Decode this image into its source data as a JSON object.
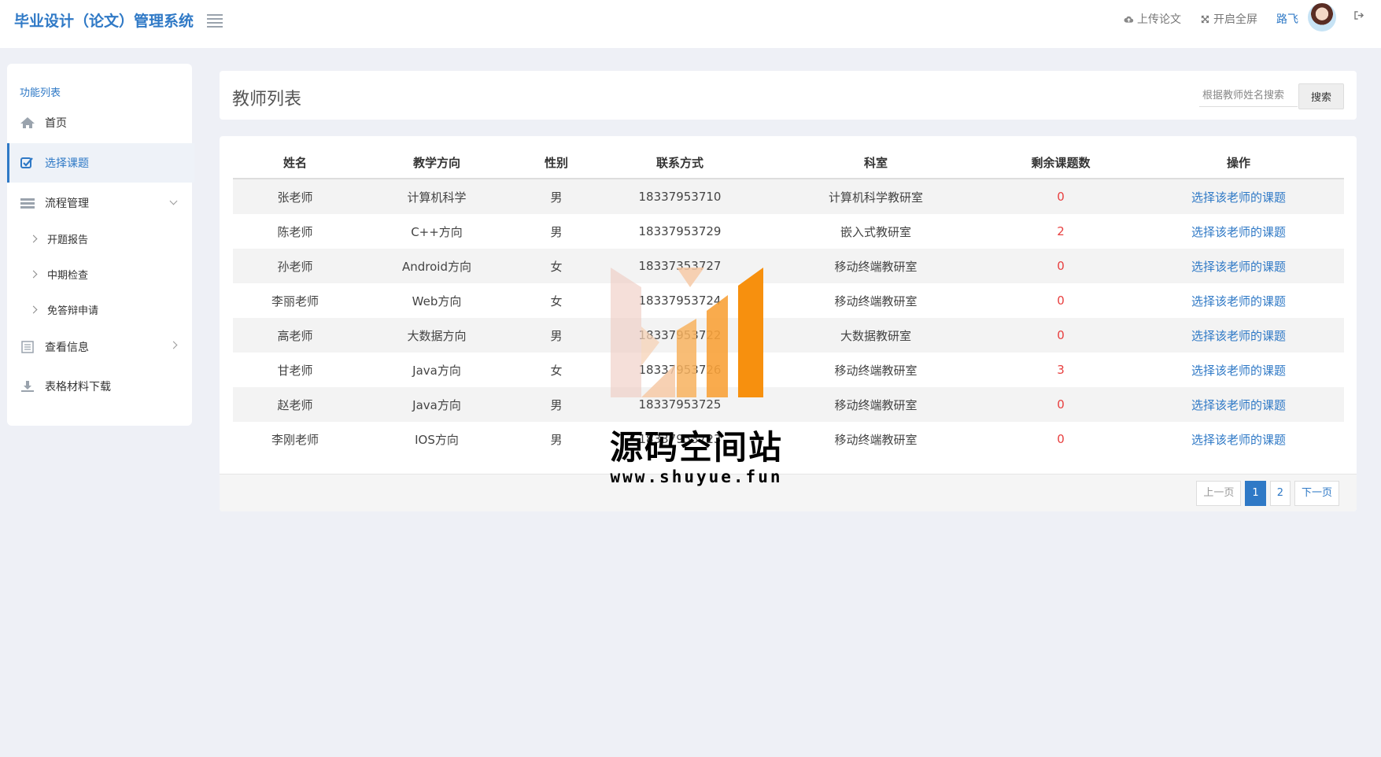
{
  "app": {
    "title": "毕业设计（论文）管理系统"
  },
  "topbar": {
    "upload": "上传论文",
    "fullscreen": "开启全屏",
    "user": "路飞"
  },
  "sidebar": {
    "title": "功能列表",
    "items": [
      {
        "label": "首页",
        "icon": "home-icon"
      },
      {
        "label": "选择课题",
        "icon": "check-square-icon"
      },
      {
        "label": "流程管理",
        "icon": "list-icon"
      },
      {
        "label": "查看信息",
        "icon": "clipboard-icon"
      },
      {
        "label": "表格材料下载",
        "icon": "download-icon"
      }
    ],
    "subitems": [
      "开题报告",
      "中期检查",
      "免答辩申请"
    ]
  },
  "page": {
    "title": "教师列表"
  },
  "search": {
    "placeholder": "根据教师姓名搜索",
    "button": "搜索"
  },
  "table": {
    "headers": [
      "姓名",
      "教学方向",
      "性别",
      "联系方式",
      "科室",
      "剩余课题数",
      "操作"
    ],
    "rows": [
      {
        "name": "张老师",
        "direction": "计算机科学",
        "gender": "男",
        "phone": "18337953710",
        "dept": "计算机科学教研室",
        "count": "0",
        "action": "选择该老师的课题"
      },
      {
        "name": "陈老师",
        "direction": "C++方向",
        "gender": "男",
        "phone": "18337953729",
        "dept": "嵌入式教研室",
        "count": "2",
        "action": "选择该老师的课题"
      },
      {
        "name": "孙老师",
        "direction": "Android方向",
        "gender": "女",
        "phone": "18337353727",
        "dept": "移动终端教研室",
        "count": "0",
        "action": "选择该老师的课题"
      },
      {
        "name": "李丽老师",
        "direction": "Web方向",
        "gender": "女",
        "phone": "18337953724",
        "dept": "移动终端教研室",
        "count": "0",
        "action": "选择该老师的课题"
      },
      {
        "name": "高老师",
        "direction": "大数据方向",
        "gender": "男",
        "phone": "18337953722",
        "dept": "大数据教研室",
        "count": "0",
        "action": "选择该老师的课题"
      },
      {
        "name": "甘老师",
        "direction": "Java方向",
        "gender": "女",
        "phone": "18337953726",
        "dept": "移动终端教研室",
        "count": "3",
        "action": "选择该老师的课题"
      },
      {
        "name": "赵老师",
        "direction": "Java方向",
        "gender": "男",
        "phone": "18337953725",
        "dept": "移动终端教研室",
        "count": "0",
        "action": "选择该老师的课题"
      },
      {
        "name": "李刚老师",
        "direction": "IOS方向",
        "gender": "男",
        "phone": "18337953723",
        "dept": "移动终端教研室",
        "count": "0",
        "action": "选择该老师的课题"
      }
    ]
  },
  "pagination": {
    "prev": "上一页",
    "pages": [
      "1",
      "2"
    ],
    "current": "1",
    "next": "下一页"
  },
  "watermark": {
    "text": "源码空间站",
    "url": "www.shuyue.fun"
  },
  "colors": {
    "accent": "#2f79c6",
    "count": "#e84040",
    "background": "#eef0f6"
  }
}
